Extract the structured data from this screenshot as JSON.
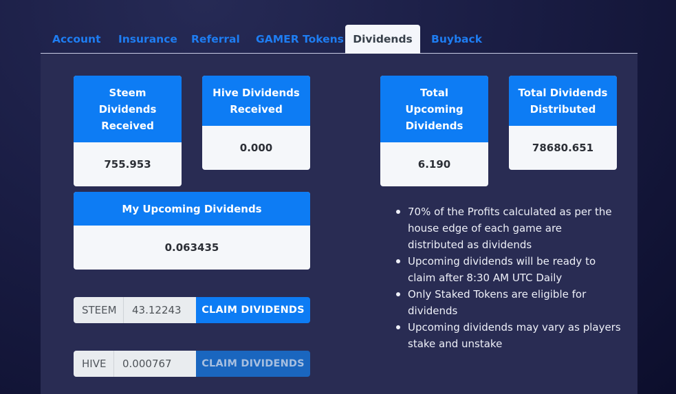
{
  "tabs": [
    {
      "label": "Account"
    },
    {
      "label": "Insurance"
    },
    {
      "label": "Referral"
    },
    {
      "label": "GAMER Tokens"
    },
    {
      "label": "Dividends",
      "active": true
    },
    {
      "label": "Buyback"
    }
  ],
  "cards": {
    "steem_received": {
      "title": "Steem Dividends Received",
      "value": "755.953"
    },
    "hive_received": {
      "title": "Hive Dividends Received",
      "value": "0.000"
    },
    "total_upcoming": {
      "title": "Total Upcoming Dividends",
      "value": "6.190"
    },
    "total_distributed": {
      "title": "Total Dividends Distributed",
      "value": "78680.651"
    },
    "my_upcoming": {
      "title": "My Upcoming Dividends",
      "value": "0.063435"
    }
  },
  "claims": {
    "steem": {
      "prefix": "STEEM",
      "value": "43.12243",
      "button": "CLAIM DIVIDENDS"
    },
    "hive": {
      "prefix": "HIVE",
      "value": "0.000767",
      "button": "CLAIM DIVIDENDS",
      "disabled": true
    }
  },
  "info": [
    "70% of the Profits calculated as per the house edge of each game are distributed as dividends",
    "Upcoming dividends will be ready to claim after 8:30 AM UTC Daily",
    "Only Staked Tokens are eligible for dividends",
    "Upcoming dividends may vary as players stake and unstake"
  ],
  "colors": {
    "accent": "#0d7cf4",
    "panel": "#292c53",
    "card_body": "#f5f7fa"
  }
}
